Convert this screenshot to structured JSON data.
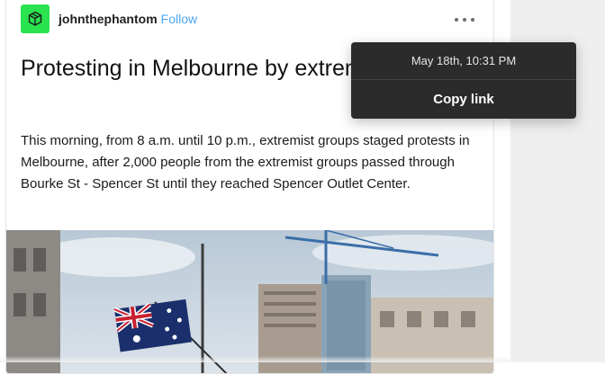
{
  "post": {
    "username": "johnthephantom",
    "follow_label": "Follow",
    "title": "Protesting in Melbourne by extremist groups",
    "body": "This morning, from 8 a.m. until 10 p.m., extremist groups staged protests in Melbourne, after 2,000 people from the extremist groups passed through Bourke St - Spencer St until they reached Spencer Outlet Center."
  },
  "popover": {
    "timestamp": "May 18th, 10:31 PM",
    "copy_link_label": "Copy link"
  },
  "colors": {
    "avatar_bg": "#2ae34f",
    "follow_link": "#4aa6f4",
    "popover_bg": "#2b2b2b"
  },
  "icons": {
    "avatar": "cube-icon",
    "more": "more-dots-icon"
  }
}
